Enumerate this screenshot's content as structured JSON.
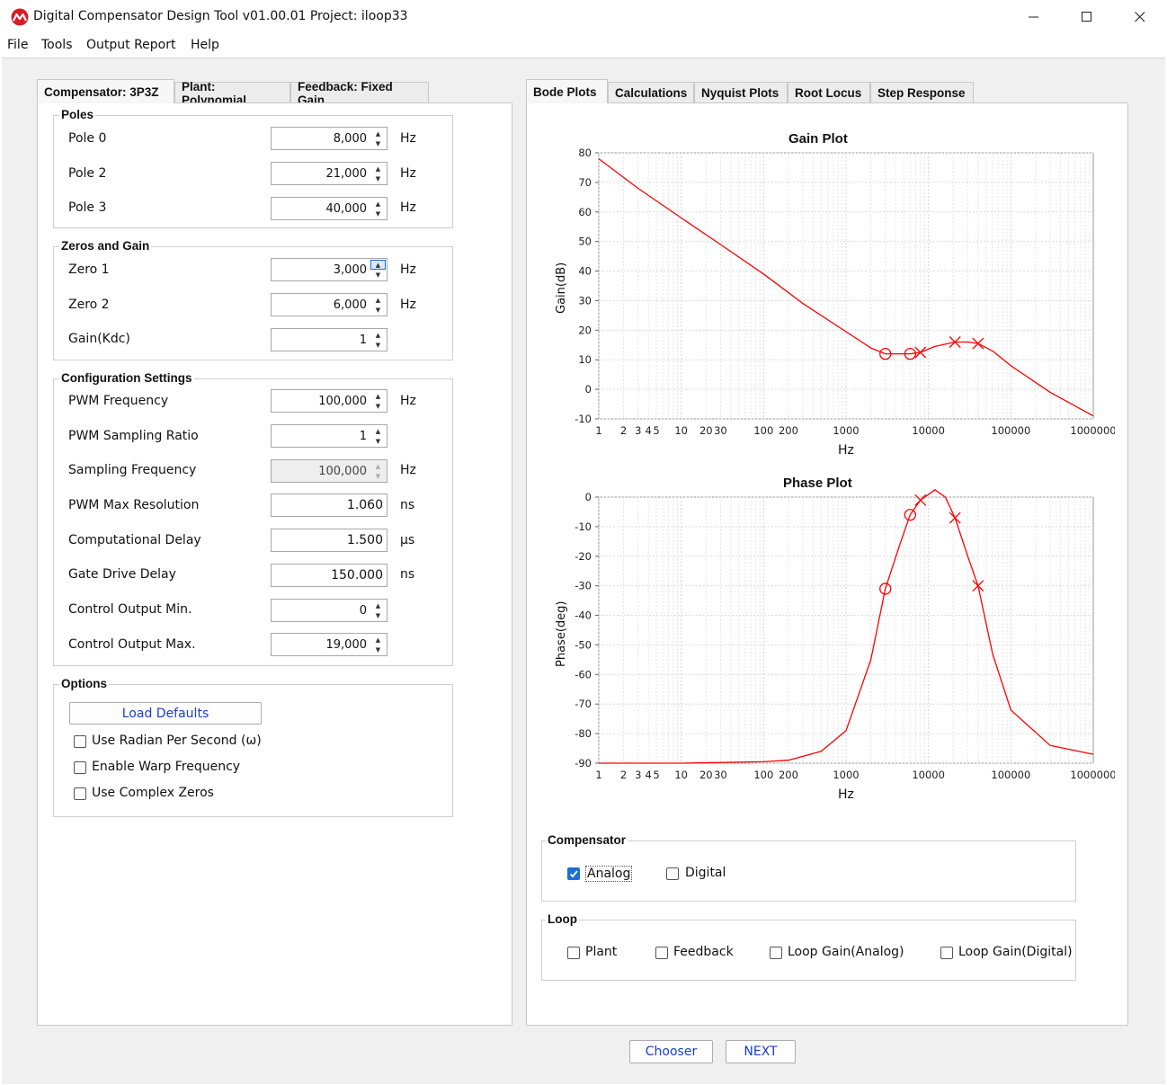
{
  "window": {
    "title": "Digital Compensator Design Tool v01.00.01 Project: iloop33",
    "brand_color": "#d81e25"
  },
  "menu": [
    "File",
    "Tools",
    "Output Report",
    "Help"
  ],
  "left_tabs": [
    "Compensator: 3P3Z",
    "Plant: Polynomial",
    "Feedback: Fixed Gain"
  ],
  "right_tabs": [
    "Bode Plots",
    "Calculations",
    "Nyquist Plots",
    "Root Locus",
    "Step Response"
  ],
  "poles": {
    "title": "Poles",
    "rows": [
      {
        "label": "Pole 0",
        "value": "8,000",
        "unit": "Hz"
      },
      {
        "label": "Pole 2",
        "value": "21,000",
        "unit": "Hz"
      },
      {
        "label": "Pole 3",
        "value": "40,000",
        "unit": "Hz"
      }
    ]
  },
  "zeros": {
    "title": "Zeros and Gain",
    "rows": [
      {
        "label": "Zero 1",
        "value": "3,000",
        "unit": "Hz"
      },
      {
        "label": "Zero 2",
        "value": "6,000",
        "unit": "Hz"
      },
      {
        "label": "Gain(Kdc)",
        "value": "1",
        "unit": ""
      }
    ]
  },
  "config": {
    "title": "Configuration Settings",
    "rows": [
      {
        "label": "PWM Frequency",
        "value": "100,000",
        "unit": "Hz"
      },
      {
        "label": "PWM Sampling Ratio",
        "value": "1",
        "unit": ""
      },
      {
        "label": "Sampling Frequency",
        "value": "100,000",
        "unit": "Hz"
      },
      {
        "label": "PWM Max Resolution",
        "value": "1.060",
        "unit": "ns"
      },
      {
        "label": "Computational Delay",
        "value": "1.500",
        "unit": "μs"
      },
      {
        "label": "Gate Drive Delay",
        "value": "150.000",
        "unit": "ns"
      },
      {
        "label": "Control Output Min.",
        "value": "0",
        "unit": ""
      },
      {
        "label": "Control Output Max.",
        "value": "19,000",
        "unit": ""
      }
    ]
  },
  "options": {
    "title": "Options",
    "load_defaults": "Load Defaults",
    "checks": [
      "Use Radian Per Second (ω)",
      "Enable Warp Frequency",
      "Use Complex Zeros"
    ]
  },
  "compensator_group": {
    "title": "Compensator",
    "analog": "Analog",
    "digital": "Digital"
  },
  "loop_group": {
    "title": "Loop",
    "items": [
      "Plant",
      "Feedback",
      "Loop Gain(Analog)",
      "Loop Gain(Digital)"
    ]
  },
  "buttons": {
    "chooser": "Chooser",
    "next": "NEXT"
  },
  "chart_data": [
    {
      "type": "line",
      "title": "Gain Plot",
      "xlabel": "Hz",
      "ylabel": "Gain(dB)",
      "xscale": "log",
      "xlim": [
        1,
        1000000
      ],
      "ylim": [
        -10,
        80
      ],
      "x_tick_labels": [
        "1",
        "2",
        "3",
        "4",
        "5",
        "10",
        "20",
        "30",
        "100",
        "200",
        "1000",
        "10000",
        "100000",
        "1000000"
      ],
      "y_ticks": [
        -10,
        0,
        10,
        20,
        30,
        40,
        50,
        60,
        70,
        80
      ],
      "grid": true,
      "series_color": "#ff0000",
      "series": [
        {
          "x": [
            1,
            3,
            10,
            30,
            100,
            300,
            1000,
            2000,
            3000,
            6000,
            8000,
            12000,
            21000,
            30000,
            40000,
            60000,
            100000,
            300000,
            1000000
          ],
          "y": [
            78,
            68,
            58,
            49,
            39,
            29,
            19.5,
            14,
            12,
            12,
            12.5,
            14.5,
            16,
            16,
            15.5,
            13,
            8,
            -1,
            -9
          ]
        }
      ],
      "zeros": [
        {
          "x": 3000,
          "y": 12
        },
        {
          "x": 6000,
          "y": 12
        }
      ],
      "poles": [
        {
          "x": 8000,
          "y": 12.5
        },
        {
          "x": 21000,
          "y": 16
        },
        {
          "x": 40000,
          "y": 15.5
        }
      ]
    },
    {
      "type": "line",
      "title": "Phase Plot",
      "xlabel": "Hz",
      "ylabel": "Phase(deg)",
      "xscale": "log",
      "xlim": [
        1,
        1000000
      ],
      "ylim": [
        -90,
        0
      ],
      "x_tick_labels": [
        "1",
        "2",
        "3",
        "4",
        "5",
        "10",
        "20",
        "30",
        "100",
        "200",
        "1000",
        "10000",
        "100000",
        "1000000"
      ],
      "y_ticks": [
        -90,
        -80,
        -70,
        -60,
        -50,
        -40,
        -30,
        -20,
        -10,
        0
      ],
      "grid": true,
      "series_color": "#ff0000",
      "series": [
        {
          "x": [
            1,
            10,
            100,
            200,
            500,
            1000,
            2000,
            3000,
            4500,
            6000,
            8000,
            12000,
            16000,
            21000,
            30000,
            40000,
            60000,
            100000,
            300000,
            1000000
          ],
          "y": [
            -90,
            -90,
            -89.5,
            -89,
            -86,
            -79,
            -55,
            -31,
            -16,
            -6,
            -1,
            2.5,
            0,
            -7,
            -20,
            -30,
            -53,
            -72,
            -84,
            -87
          ]
        }
      ],
      "zeros": [
        {
          "x": 3000,
          "y": -31
        },
        {
          "x": 6000,
          "y": -6
        }
      ],
      "poles": [
        {
          "x": 8000,
          "y": -1
        },
        {
          "x": 21000,
          "y": -7
        },
        {
          "x": 40000,
          "y": -30
        }
      ]
    }
  ]
}
